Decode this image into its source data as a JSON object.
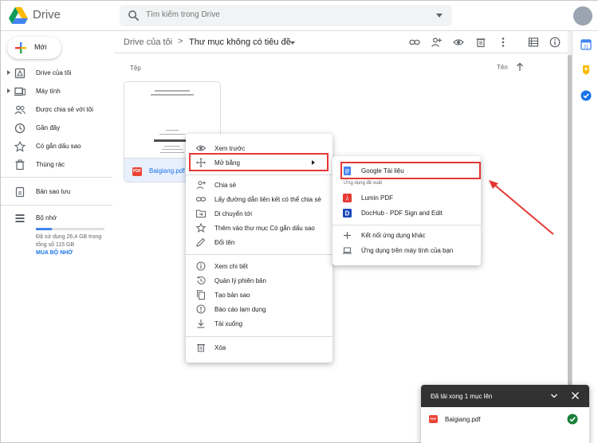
{
  "header": {
    "app_name": "Drive",
    "search_placeholder": "Tìm kiếm trong Drive"
  },
  "sidebar": {
    "new_label": "Mới",
    "items": [
      {
        "label": "Drive của tôi",
        "icon": "drive-icon"
      },
      {
        "label": "Máy tính",
        "icon": "computer-icon"
      },
      {
        "label": "Được chia sẻ với tôi",
        "icon": "shared-icon"
      },
      {
        "label": "Gần đây",
        "icon": "clock-icon"
      },
      {
        "label": "Có gắn dấu sao",
        "icon": "star-icon"
      },
      {
        "label": "Thùng rác",
        "icon": "trash-icon"
      }
    ],
    "backup_label": "Bản sao lưu",
    "storage_label": "Bộ nhớ",
    "storage_text": "Đã sử dụng 26,4 GB trong tổng số 115 GB",
    "storage_used_fraction": 0.23,
    "buy_label": "MUA BỘ NHỚ"
  },
  "breadcrumb": {
    "root": "Drive của tôi",
    "separator": ">",
    "current": "Thư mục không có tiêu đề"
  },
  "toolbar_icons": [
    "link-icon",
    "share-person-icon",
    "preview-eye-icon",
    "delete-icon",
    "more-vert-icon",
    "list-view-icon",
    "info-icon"
  ],
  "files": {
    "section_label": "Tệp",
    "sort_label": "Tên",
    "items": [
      {
        "name": "Baigiang.pdf",
        "type_badge": "PDF"
      }
    ]
  },
  "context_menu": {
    "items": [
      {
        "label": "Xem trước",
        "icon": "eye-icon"
      },
      {
        "label": "Mở bằng",
        "icon": "move-arrows-icon",
        "has_submenu": true,
        "highlighted": true
      },
      {
        "label": "Chia sẻ",
        "icon": "person-add-icon"
      },
      {
        "label": "Lấy đường dẫn liên kết có thể chia sẻ",
        "icon": "link-icon"
      },
      {
        "label": "Di chuyển tới",
        "icon": "folder-move-icon"
      },
      {
        "label": "Thêm vào thư mục Có gắn dấu sao",
        "icon": "star-icon"
      },
      {
        "label": "Đổi tên",
        "icon": "edit-icon"
      },
      {
        "label": "Xem chi tiết",
        "icon": "info-icon"
      },
      {
        "label": "Quản lý phiên bản",
        "icon": "history-icon"
      },
      {
        "label": "Tạo bản sao",
        "icon": "copy-icon"
      },
      {
        "label": "Báo cáo lạm dụng",
        "icon": "report-icon"
      },
      {
        "label": "Tải xuống",
        "icon": "download-icon"
      },
      {
        "label": "Xóa",
        "icon": "trash-icon"
      }
    ]
  },
  "submenu": {
    "primary": {
      "label": "Google Tài liệu",
      "icon": "google-docs-icon",
      "highlighted": true
    },
    "suggested_heading": "Ứng dụng đề xuất",
    "suggested": [
      {
        "label": "Lumin PDF",
        "icon": "lumin-pdf-icon"
      },
      {
        "label": "DocHub - PDF Sign and Edit",
        "icon": "dochub-icon"
      }
    ],
    "more": [
      {
        "label": "Kết nối ứng dụng khác",
        "icon": "plus-icon"
      },
      {
        "label": "Ứng dụng trên máy tính của bạn",
        "icon": "laptop-icon"
      }
    ]
  },
  "toast": {
    "title": "Đã tải xong 1 mục lên",
    "file_name": "Baigiang.pdf",
    "file_badge": "PDF",
    "status": "complete"
  },
  "colors": {
    "accent_blue": "#1a73e8",
    "highlight_red": "#e53935",
    "toast_dark": "#323232",
    "success_green": "#188038"
  }
}
